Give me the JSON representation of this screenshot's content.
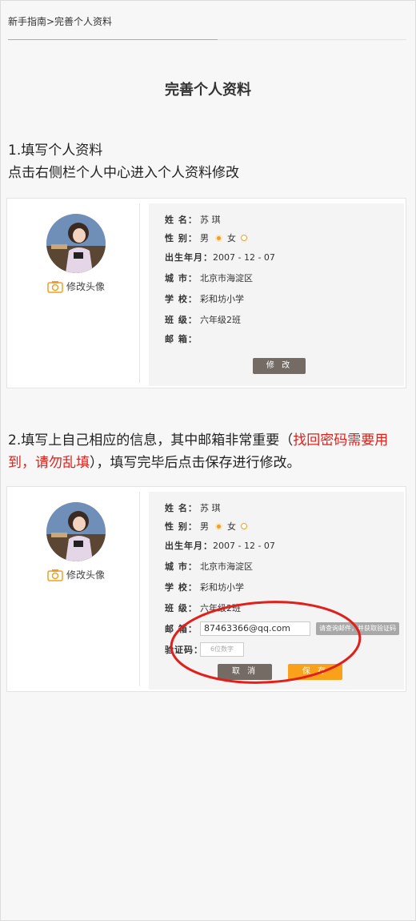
{
  "breadcrumb": "新手指南>完善个人资料",
  "page_title": "完善个人资料",
  "step1": {
    "line1": "1.填写个人资料",
    "line2": "点击右侧栏个人中心进入个人资料修改"
  },
  "step2": {
    "text_a": "2.填写上自己相应的信息，其中邮箱非常重要（",
    "text_red": "找回密码需要用到，请勿乱填",
    "text_b": "），填写完毕后点击保存进行修改。"
  },
  "profile": {
    "change_avatar": "修改头像",
    "name_label": "姓 名：",
    "name": "苏 琪",
    "gender_label": "性 别：",
    "male": "男",
    "female": "女",
    "birth_label": "出生年月：",
    "birth": "2007 - 12 - 07",
    "city_label": "城 市：",
    "city": "北京市海淀区",
    "school_label": "学 校：",
    "school": "彩和坊小学",
    "class_label": "班 级：",
    "class": "六年级2班",
    "email_label": "邮 箱：",
    "email": "87463366@qq.com",
    "code_label": "验证码：",
    "code_placeholder": "6位数字",
    "get_code": "请查询邮件，并获取验证码",
    "edit_button": "修 改",
    "cancel_button": "取 消",
    "save_button": "保 存"
  },
  "colors": {
    "accent": "#f9a11b",
    "red": "#e0201b",
    "button_gray": "#746b64"
  }
}
